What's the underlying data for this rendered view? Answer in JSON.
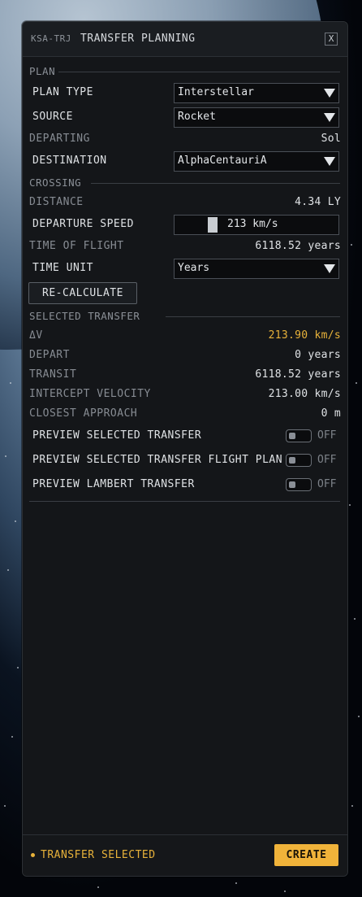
{
  "window": {
    "code": "KSA-TRJ",
    "title": "TRANSFER PLANNING",
    "close_label": "X"
  },
  "plan": {
    "section_label": "PLAN",
    "plan_type": {
      "label": "PLAN TYPE",
      "value": "Interstellar"
    },
    "source": {
      "label": "SOURCE",
      "value": "Rocket"
    },
    "departing": {
      "label": "DEPARTING",
      "value": "Sol"
    },
    "destination": {
      "label": "DESTINATION",
      "value": "AlphaCentauriA"
    }
  },
  "crossing": {
    "section_label": "CROSSING",
    "distance": {
      "label": "DISTANCE",
      "value": "4.34 LY"
    },
    "departure_speed": {
      "label": "DEPARTURE SPEED",
      "value": "213 km/s",
      "level": 0.2
    },
    "time_of_flight": {
      "label": "TIME OF FLIGHT",
      "value": "6118.52 years"
    },
    "time_unit": {
      "label": "TIME UNIT",
      "value": "Years"
    },
    "recalculate_label": "RE-CALCULATE"
  },
  "selected": {
    "section_label": "SELECTED TRANSFER",
    "dv": {
      "label": "ΔV",
      "value": "213.90 km/s"
    },
    "depart": {
      "label": "DEPART",
      "value": "0 years"
    },
    "transit": {
      "label": "TRANSIT",
      "value": "6118.52 years"
    },
    "intercept_velocity": {
      "label": "INTERCEPT VELOCITY",
      "value": "213.00 km/s"
    },
    "closest_approach": {
      "label": "CLOSEST APPROACH",
      "value": "0 m"
    },
    "toggles": [
      {
        "label": "PREVIEW SELECTED TRANSFER",
        "state": "OFF"
      },
      {
        "label": "PREVIEW SELECTED TRANSFER FLIGHT PLAN",
        "state": "OFF"
      },
      {
        "label": "PREVIEW LAMBERT TRANSFER",
        "state": "OFF"
      }
    ]
  },
  "footer": {
    "status": "TRANSFER SELECTED",
    "create_label": "CREATE"
  },
  "colors": {
    "accent": "#e8b23a",
    "panel": "#141619",
    "text": "#dfe2e5",
    "muted": "#878c93"
  }
}
